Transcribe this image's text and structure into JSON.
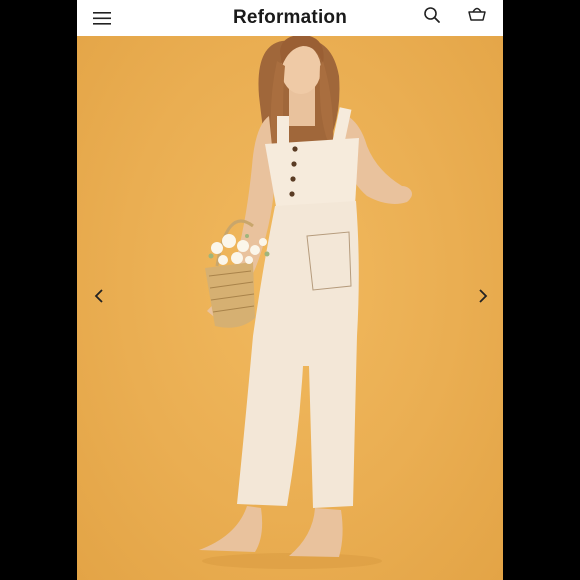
{
  "header": {
    "brand": "Reformation",
    "menu_icon": "hamburger-menu-icon",
    "search_icon": "search-icon",
    "bag_icon": "shopping-bag-icon"
  },
  "gallery": {
    "prev_icon": "chevron-left-icon",
    "next_icon": "chevron-right-icon",
    "background_color": "#e9ae52"
  }
}
